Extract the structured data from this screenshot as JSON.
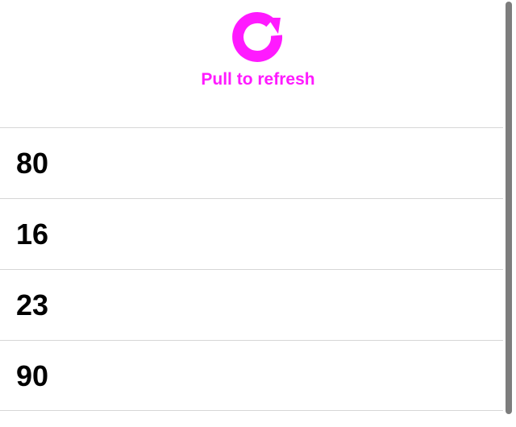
{
  "refresh": {
    "label": "Pull to refresh",
    "accent_color": "#ff1aff",
    "icon": "refresh-spinner-icon"
  },
  "list": {
    "items": [
      {
        "value": "80"
      },
      {
        "value": "16"
      },
      {
        "value": "23"
      },
      {
        "value": "90"
      }
    ]
  }
}
